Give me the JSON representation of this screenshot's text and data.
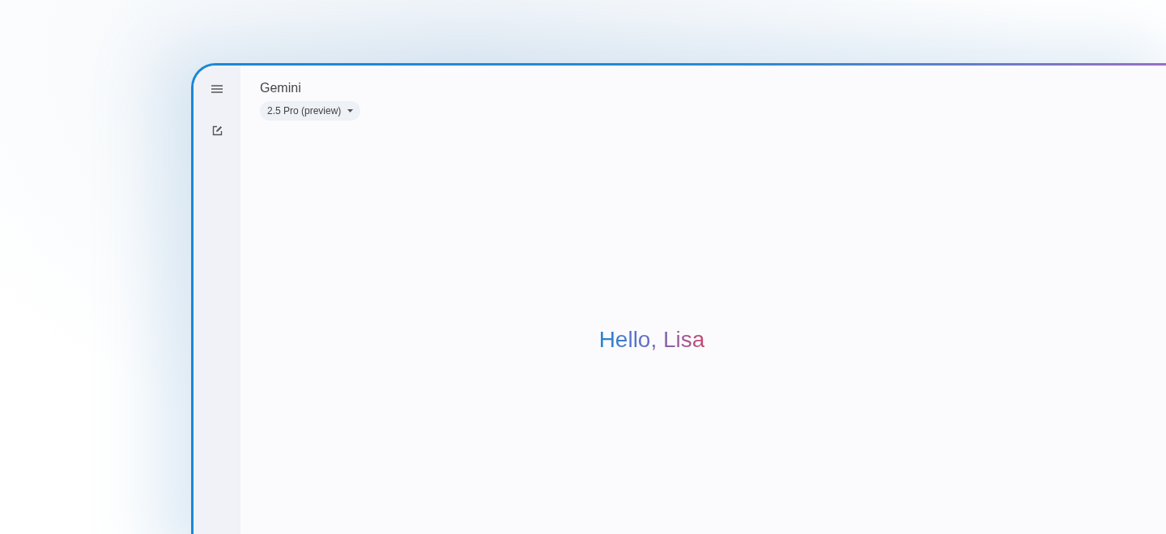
{
  "app": {
    "title": "Gemini",
    "model_selector": "2.5 Pro (preview)"
  },
  "greeting": "Hello, Lisa"
}
